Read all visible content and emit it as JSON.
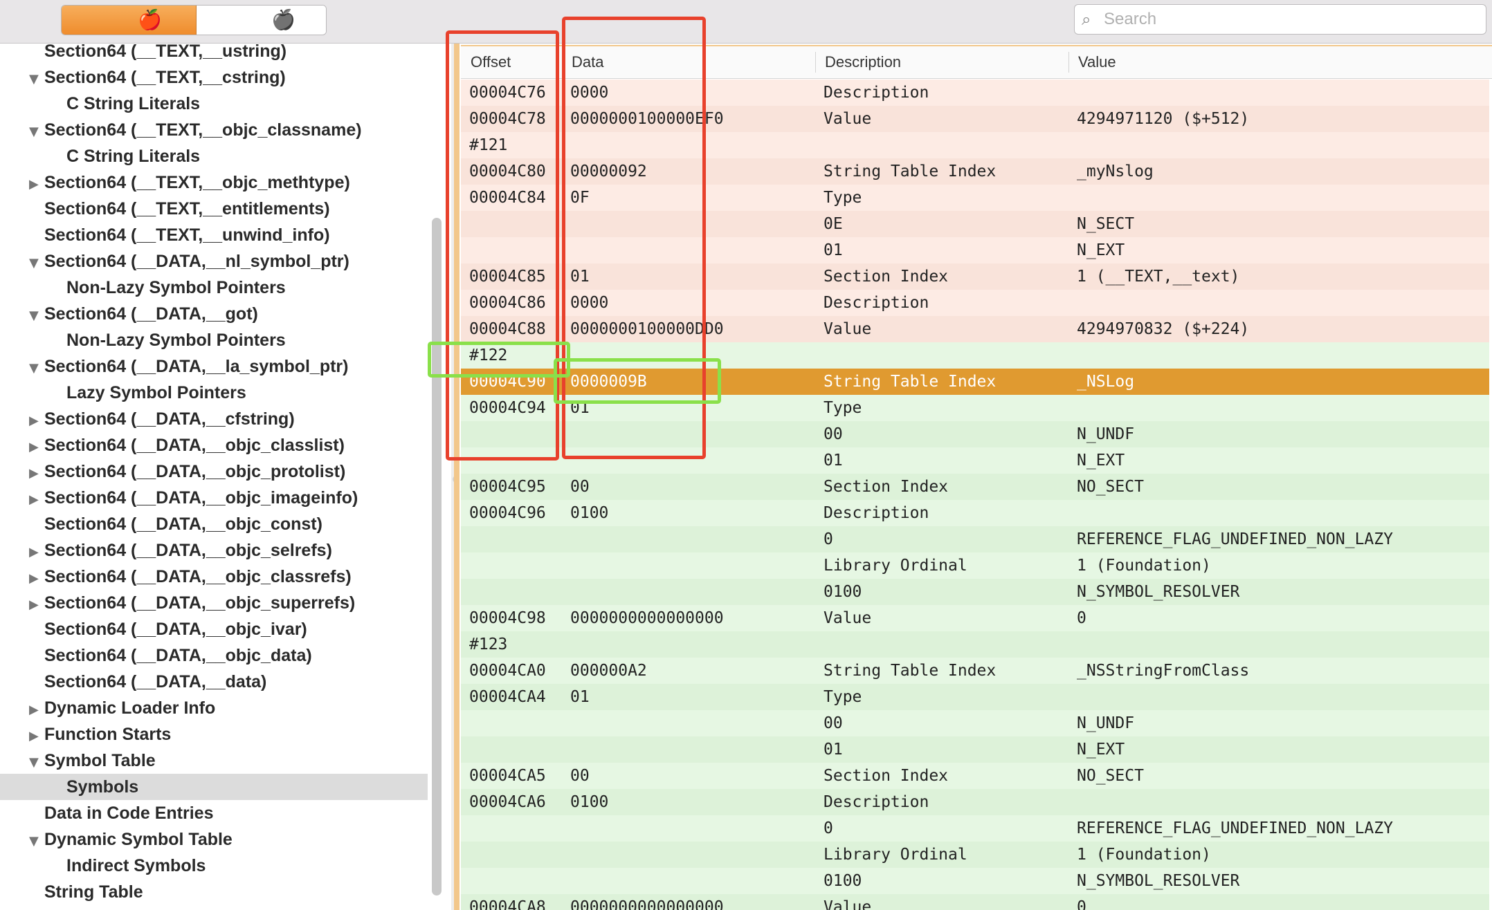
{
  "toolbar": {
    "search_placeholder": "Search",
    "segment_left_icon": "apple-icon-orange",
    "segment_right_icon": "apple-icon-gray",
    "apple_glyph": "🍎"
  },
  "sidebar": {
    "items": [
      {
        "label": "Section64 (__TEXT,__ustring)",
        "indent": 1,
        "toggle": ""
      },
      {
        "label": "Section64 (__TEXT,__cstring)",
        "indent": 1,
        "toggle": "▼"
      },
      {
        "label": "C String Literals",
        "indent": 2,
        "toggle": ""
      },
      {
        "label": "Section64 (__TEXT,__objc_classname)",
        "indent": 1,
        "toggle": "▼"
      },
      {
        "label": "C String Literals",
        "indent": 2,
        "toggle": ""
      },
      {
        "label": "Section64 (__TEXT,__objc_methtype)",
        "indent": 1,
        "toggle": "▶"
      },
      {
        "label": "Section64 (__TEXT,__entitlements)",
        "indent": 1,
        "toggle": ""
      },
      {
        "label": "Section64 (__TEXT,__unwind_info)",
        "indent": 1,
        "toggle": ""
      },
      {
        "label": "Section64 (__DATA,__nl_symbol_ptr)",
        "indent": 1,
        "toggle": "▼"
      },
      {
        "label": "Non-Lazy Symbol Pointers",
        "indent": 2,
        "toggle": ""
      },
      {
        "label": "Section64 (__DATA,__got)",
        "indent": 1,
        "toggle": "▼"
      },
      {
        "label": "Non-Lazy Symbol Pointers",
        "indent": 2,
        "toggle": ""
      },
      {
        "label": "Section64 (__DATA,__la_symbol_ptr)",
        "indent": 1,
        "toggle": "▼"
      },
      {
        "label": "Lazy Symbol Pointers",
        "indent": 2,
        "toggle": ""
      },
      {
        "label": "Section64 (__DATA,__cfstring)",
        "indent": 1,
        "toggle": "▶"
      },
      {
        "label": "Section64 (__DATA,__objc_classlist)",
        "indent": 1,
        "toggle": "▶"
      },
      {
        "label": "Section64 (__DATA,__objc_protolist)",
        "indent": 1,
        "toggle": "▶"
      },
      {
        "label": "Section64 (__DATA,__objc_imageinfo)",
        "indent": 1,
        "toggle": "▶"
      },
      {
        "label": "Section64 (__DATA,__objc_const)",
        "indent": 1,
        "toggle": ""
      },
      {
        "label": "Section64 (__DATA,__objc_selrefs)",
        "indent": 1,
        "toggle": "▶"
      },
      {
        "label": "Section64 (__DATA,__objc_classrefs)",
        "indent": 1,
        "toggle": "▶"
      },
      {
        "label": "Section64 (__DATA,__objc_superrefs)",
        "indent": 1,
        "toggle": "▶"
      },
      {
        "label": "Section64 (__DATA,__objc_ivar)",
        "indent": 1,
        "toggle": ""
      },
      {
        "label": "Section64 (__DATA,__objc_data)",
        "indent": 1,
        "toggle": ""
      },
      {
        "label": "Section64 (__DATA,__data)",
        "indent": 1,
        "toggle": ""
      },
      {
        "label": "Dynamic Loader Info",
        "indent": 0,
        "toggle": "▶"
      },
      {
        "label": "Function Starts",
        "indent": 0,
        "toggle": "▶"
      },
      {
        "label": "Symbol Table",
        "indent": 0,
        "toggle": "▼"
      },
      {
        "label": "Symbols",
        "indent": 2,
        "toggle": "",
        "selected": true
      },
      {
        "label": "Data in Code Entries",
        "indent": 0,
        "toggle": ""
      },
      {
        "label": "Dynamic Symbol Table",
        "indent": 0,
        "toggle": "▼"
      },
      {
        "label": "Indirect Symbols",
        "indent": 2,
        "toggle": ""
      },
      {
        "label": "String Table",
        "indent": 0,
        "toggle": ""
      }
    ]
  },
  "table": {
    "headers": {
      "offset": "Offset",
      "data": "Data",
      "description": "Description",
      "value": "Value"
    },
    "rows": [
      {
        "o": "00004C76",
        "d": "0000",
        "s": "Description",
        "v": "",
        "bg": "pink"
      },
      {
        "o": "00004C78",
        "d": "0000000100000EF0",
        "s": "Value",
        "v": "4294971120 ($+512)",
        "bg": "pink",
        "div": true
      },
      {
        "o": "#121",
        "d": "",
        "s": "",
        "v": "",
        "bg": "pink"
      },
      {
        "o": "00004C80",
        "d": "00000092",
        "s": "String Table Index",
        "v": "_myNslog",
        "bg": "pink"
      },
      {
        "o": "00004C84",
        "d": "0F",
        "s": "Type",
        "v": "",
        "bg": "pink"
      },
      {
        "o": "",
        "d": "",
        "s": "0E",
        "v": "N_SECT",
        "bg": "pink"
      },
      {
        "o": "",
        "d": "",
        "s": "01",
        "v": "N_EXT",
        "bg": "pink"
      },
      {
        "o": "00004C85",
        "d": "01",
        "s": "Section Index",
        "v": "1 (__TEXT,__text)",
        "bg": "pink"
      },
      {
        "o": "00004C86",
        "d": "0000",
        "s": "Description",
        "v": "",
        "bg": "pink"
      },
      {
        "o": "00004C88",
        "d": "0000000100000DD0",
        "s": "Value",
        "v": "4294970832 ($+224)",
        "bg": "pink",
        "div": true
      },
      {
        "o": "#122",
        "d": "",
        "s": "",
        "v": "",
        "bg": "green"
      },
      {
        "o": "00004C90",
        "d": "0000009B",
        "s": "String Table Index",
        "v": "_NSLog",
        "bg": "sel"
      },
      {
        "o": "00004C94",
        "d": "01",
        "s": "Type",
        "v": "",
        "bg": "green"
      },
      {
        "o": "",
        "d": "",
        "s": "00",
        "v": "N_UNDF",
        "bg": "green"
      },
      {
        "o": "",
        "d": "",
        "s": "01",
        "v": "N_EXT",
        "bg": "green"
      },
      {
        "o": "00004C95",
        "d": "00",
        "s": "Section Index",
        "v": "NO_SECT",
        "bg": "green"
      },
      {
        "o": "00004C96",
        "d": "0100",
        "s": "Description",
        "v": "",
        "bg": "green"
      },
      {
        "o": "",
        "d": "",
        "s": "0",
        "v": "REFERENCE_FLAG_UNDEFINED_NON_LAZY",
        "bg": "green"
      },
      {
        "o": "",
        "d": "",
        "s": "Library Ordinal",
        "v": "1 (Foundation)",
        "bg": "green"
      },
      {
        "o": "",
        "d": "",
        "s": "0100",
        "v": "N_SYMBOL_RESOLVER",
        "bg": "green"
      },
      {
        "o": "00004C98",
        "d": "0000000000000000",
        "s": "Value",
        "v": "0",
        "bg": "green",
        "div": true
      },
      {
        "o": "#123",
        "d": "",
        "s": "",
        "v": "",
        "bg": "green"
      },
      {
        "o": "00004CA0",
        "d": "000000A2",
        "s": "String Table Index",
        "v": "_NSStringFromClass",
        "bg": "green"
      },
      {
        "o": "00004CA4",
        "d": "01",
        "s": "Type",
        "v": "",
        "bg": "green"
      },
      {
        "o": "",
        "d": "",
        "s": "00",
        "v": "N_UNDF",
        "bg": "green"
      },
      {
        "o": "",
        "d": "",
        "s": "01",
        "v": "N_EXT",
        "bg": "green"
      },
      {
        "o": "00004CA5",
        "d": "00",
        "s": "Section Index",
        "v": "NO_SECT",
        "bg": "green"
      },
      {
        "o": "00004CA6",
        "d": "0100",
        "s": "Description",
        "v": "",
        "bg": "green"
      },
      {
        "o": "",
        "d": "",
        "s": "0",
        "v": "REFERENCE_FLAG_UNDEFINED_NON_LAZY",
        "bg": "green"
      },
      {
        "o": "",
        "d": "",
        "s": "Library Ordinal",
        "v": "1 (Foundation)",
        "bg": "green"
      },
      {
        "o": "",
        "d": "",
        "s": "0100",
        "v": "N_SYMBOL_RESOLVER",
        "bg": "green"
      },
      {
        "o": "00004CA8",
        "d": "0000000000000000",
        "s": "Value",
        "v": "0",
        "bg": "green"
      }
    ]
  },
  "annotations": {
    "red_color": "#e8412c",
    "green_color": "#8ae04a"
  }
}
